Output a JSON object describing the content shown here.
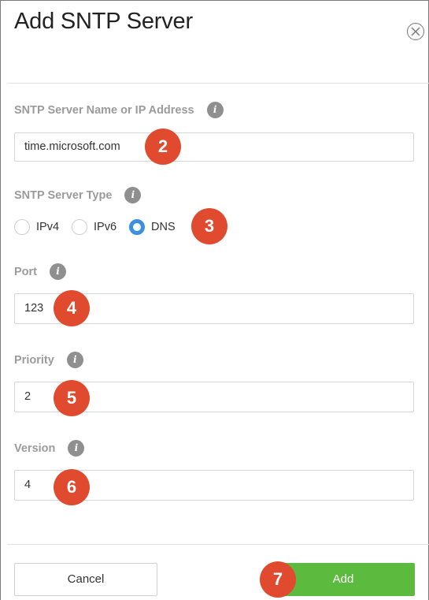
{
  "dialog": {
    "title": "Add SNTP Server"
  },
  "fields": {
    "server": {
      "label": "SNTP Server Name or IP Address",
      "value": "time.microsoft.com"
    },
    "type": {
      "label": "SNTP Server Type",
      "options": [
        "IPv4",
        "IPv6",
        "DNS"
      ],
      "selected": "DNS"
    },
    "port": {
      "label": "Port",
      "value": "123"
    },
    "priority": {
      "label": "Priority",
      "value": "2"
    },
    "version": {
      "label": "Version",
      "value": "4"
    }
  },
  "info_glyph": "i",
  "annotations": [
    "2",
    "3",
    "4",
    "5",
    "6",
    "7"
  ],
  "footer": {
    "cancel_label": "Cancel",
    "add_label": "Add"
  },
  "colors": {
    "accent_blue": "#3d8fe0",
    "add_green": "#5cbb3f",
    "annotation_red": "#e04a2f"
  },
  "icons": {
    "close": "close-circle-icon",
    "info": "info-icon"
  }
}
